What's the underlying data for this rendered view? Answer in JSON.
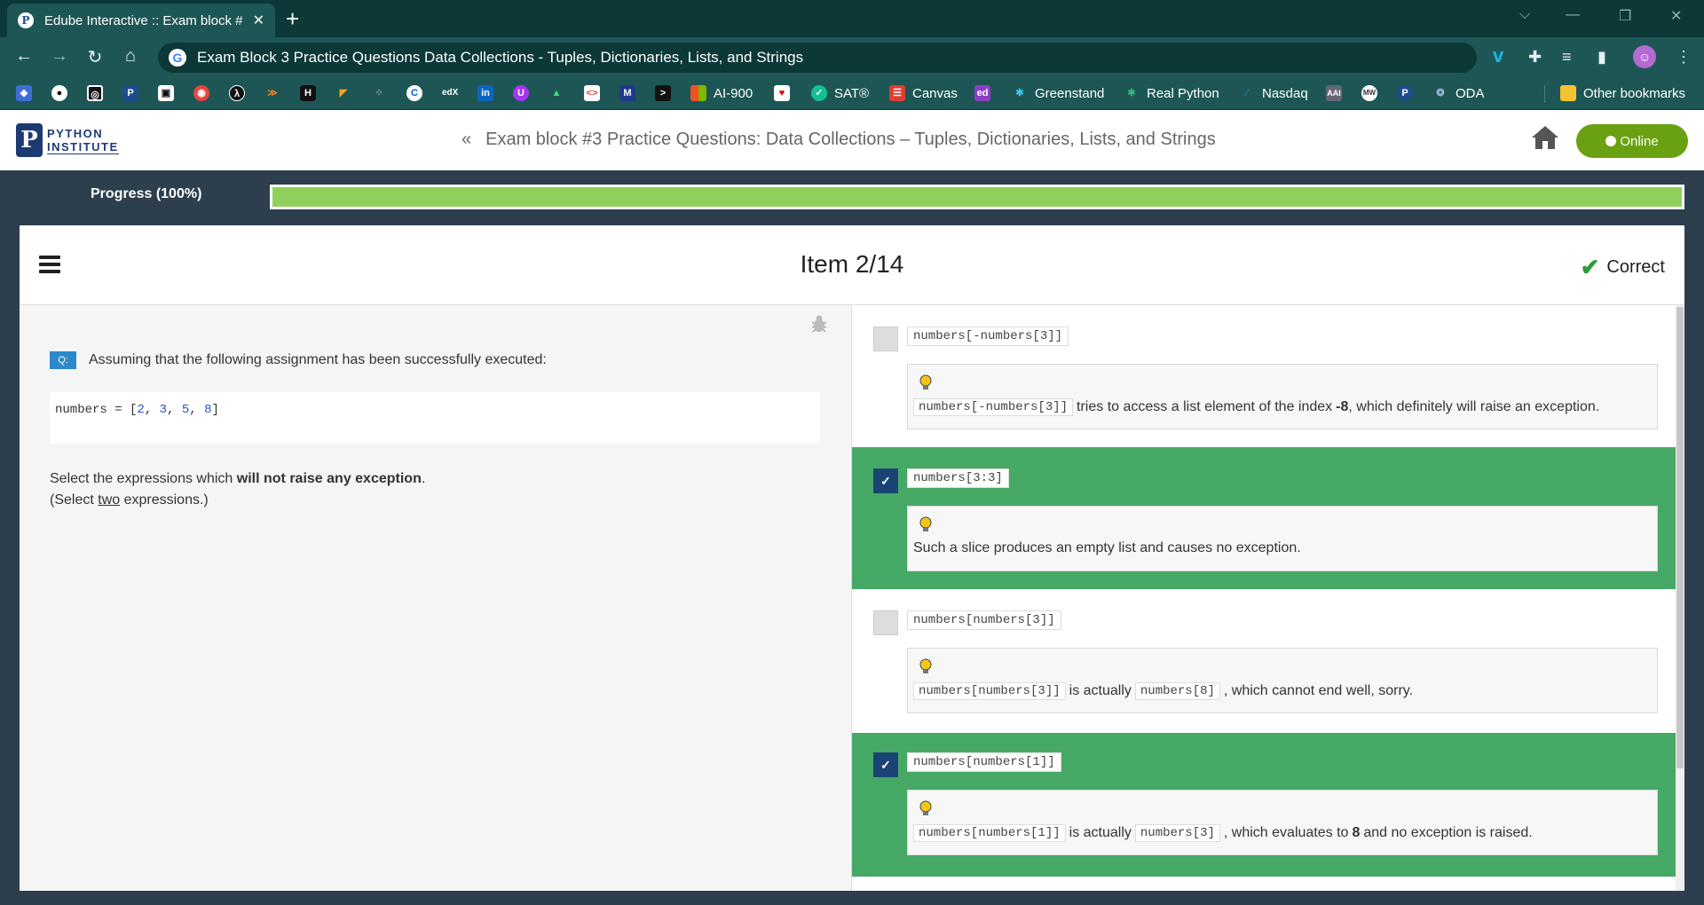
{
  "browser": {
    "tab_title": "Edube Interactive :: Exam block #",
    "tab_icon": "P",
    "close": "✕",
    "new_tab": "+",
    "address": "Exam Block 3 Practice Questions Data Collections - Tuples, Dictionaries, Lists, and Strings",
    "bookmarks": [
      {
        "label": "AI-900",
        "icon": "windows-icon",
        "color": "#f25022"
      },
      {
        "label": "SAT®",
        "icon": "khan-icon",
        "color": "#14bf96"
      },
      {
        "label": "Canvas",
        "icon": "canvas-icon",
        "color": "#e03c31"
      },
      {
        "label": "Greenstand",
        "icon": "slack-icon",
        "color": "#36c5f0"
      },
      {
        "label": "Real Python",
        "icon": "slack-icon",
        "color": "#2eb67d"
      },
      {
        "label": "Nasdaq",
        "icon": "nasdaq-icon",
        "color": "#0090ba"
      },
      {
        "label": "ODA",
        "icon": "openai-icon",
        "color": "#5a7dbf"
      }
    ],
    "other_bookmarks": "Other bookmarks"
  },
  "header": {
    "logo_line1": "PYTHON",
    "logo_line2": "INSTITUTE",
    "breadcrumb_back": "«",
    "breadcrumb": "Exam block #3 Practice Questions: Data Collections – Tuples, Dictionaries, Lists, and Strings",
    "online_label": "Online"
  },
  "progress": {
    "label": "Progress (100%)",
    "fraction": 1.0
  },
  "item": {
    "title": "Item 2/14",
    "status": "Correct"
  },
  "question": {
    "badge": "Q:",
    "intro": "Assuming that the following assignment has been successfully executed:",
    "code_var": "numbers",
    "code_eq": " = [",
    "code_values": [
      "2",
      "3",
      "5",
      "8"
    ],
    "instruction_pre": "Select the expressions which ",
    "instruction_bold": "will not raise any exception",
    "instruction_post": ".",
    "select_pre": "(Select ",
    "select_u": "two",
    "select_post": " expressions.)"
  },
  "options": [
    {
      "code": "numbers[-numbers[3]]",
      "selected": false,
      "hint_code1": "numbers[-numbers[3]]",
      "hint_text1": "tries to access a list element of the index",
      "hint_bold": "-8",
      "hint_text2": ", which definitely will raise an exception."
    },
    {
      "code": "numbers[3:3]",
      "selected": true,
      "hint_text1": "Such a slice produces an empty list and causes no exception."
    },
    {
      "code": "numbers[numbers[3]]",
      "selected": false,
      "hint_code1": "numbers[numbers[3]]",
      "hint_text1": "is actually",
      "hint_code2": "numbers[8]",
      "hint_text2": ", which cannot end well, sorry."
    },
    {
      "code": "numbers[numbers[1]]",
      "selected": true,
      "hint_code1": "numbers[numbers[1]]",
      "hint_text1": "is actually",
      "hint_code2": "numbers[3]",
      "hint_text2": ", which evaluates to",
      "hint_bold": "8",
      "hint_text3": "and no exception is raised."
    }
  ],
  "colors": {
    "selected_bg": "#45a965",
    "progress_fill": "#8fd05b",
    "online_bg": "#6aa112",
    "brand": "#1e3a73"
  }
}
